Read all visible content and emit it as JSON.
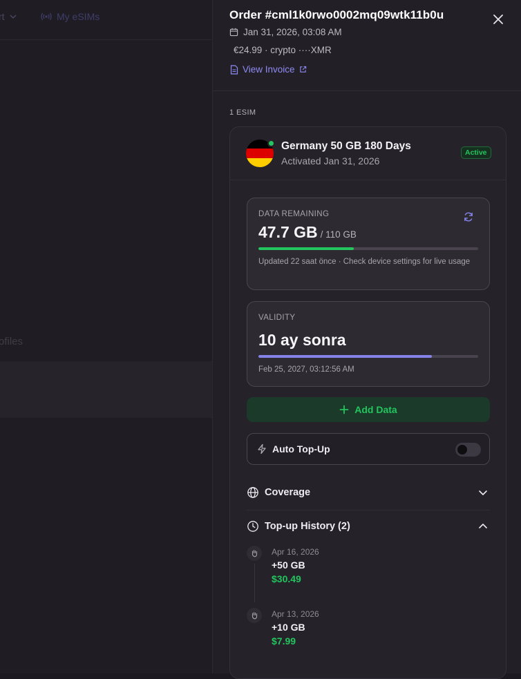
{
  "background": {
    "nav_partial_label": "rt",
    "nav_my_esims": "My eSIMs",
    "partial_text": "ofiles"
  },
  "order": {
    "title": "Order #cml1k0rwo0002mq09wtk11b0u",
    "date": "Jan 31, 2026, 03:08 AM",
    "price_line": "€24.99 · crypto ····XMR",
    "invoice_label": "View Invoice"
  },
  "esim_count_label": "1 ESIM",
  "esim": {
    "name": "Germany 50 GB 180 Days",
    "activated": "Activated Jan 31, 2026",
    "status": "Active",
    "flag_colors": [
      "#000000",
      "#dd0000",
      "#ffce00"
    ],
    "data": {
      "label": "DATA REMAINING",
      "remaining": "47.7 GB",
      "total": "/ 110 GB",
      "fraction": 0.433,
      "note": "Updated 22 saat önce · Check device settings for live usage"
    },
    "validity": {
      "label": "VALIDITY",
      "value": "10 ay sonra",
      "fraction": 0.79,
      "expires": "Feb 25, 2027, 03:12:56 AM"
    },
    "add_data_label": "Add Data",
    "auto_topup_label": "Auto Top-Up",
    "auto_topup_enabled": false,
    "coverage_label": "Coverage",
    "topup_history_label": "Top-up History (2)",
    "topups": [
      {
        "date": "Apr 16, 2026",
        "amount": "+50 GB",
        "price": "$30.49"
      },
      {
        "date": "Apr 13, 2026",
        "amount": "+10 GB",
        "price": "$7.99"
      }
    ]
  },
  "colors": {
    "accent_purple": "#8f8cf5",
    "success_green": "#22c55e",
    "drawer_bg": "#221f26"
  }
}
